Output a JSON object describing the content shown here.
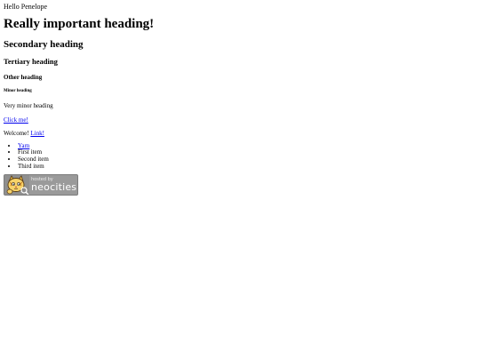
{
  "greeting": "Hello Penelope",
  "headings": {
    "h1": "Really important heading!",
    "h2": "Secondary heading",
    "h3": "Tertiary heading",
    "h4": "Other heading",
    "h5": "Minor heading",
    "h6": "Very minor heading"
  },
  "click_link": "Click me!",
  "welcome": {
    "text": "Welcome!",
    "link": "Link!"
  },
  "list": {
    "link_item": "Yarn",
    "items": [
      "First item",
      "Second item",
      "Third item"
    ]
  },
  "badge": {
    "small_text": "hosted by",
    "big_text": "neocities",
    "logo_icon": "neocities-cat-icon"
  }
}
